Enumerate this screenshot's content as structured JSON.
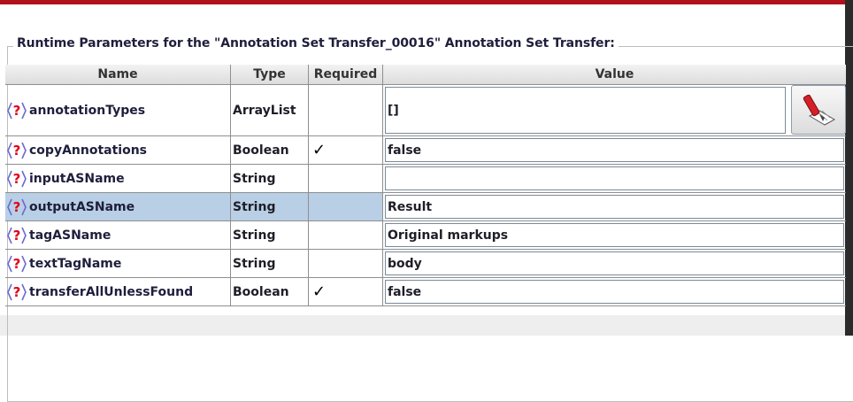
{
  "panel": {
    "title": "Runtime Parameters for the \"Annotation Set Transfer_00016\" Annotation Set Transfer:"
  },
  "table": {
    "columns": [
      "Name",
      "Type",
      "Required",
      "Value"
    ],
    "rows": [
      {
        "name": "annotationTypes",
        "type": "ArrayList",
        "required": "",
        "value": "[]",
        "selected": false
      },
      {
        "name": "copyAnnotations",
        "type": "Boolean",
        "required": "✓",
        "value": "false",
        "selected": false
      },
      {
        "name": "inputASName",
        "type": "String",
        "required": "",
        "value": "",
        "selected": false
      },
      {
        "name": "outputASName",
        "type": "String",
        "required": "",
        "value": "Result",
        "selected": true
      },
      {
        "name": "tagASName",
        "type": "String",
        "required": "",
        "value": "Original markups",
        "selected": false
      },
      {
        "name": "textTagName",
        "type": "String",
        "required": "",
        "value": "body",
        "selected": false
      },
      {
        "name": "transferAllUnlessFound",
        "type": "Boolean",
        "required": "✓",
        "value": "false",
        "selected": false
      }
    ]
  },
  "icons": {
    "param_help": "question-icon",
    "list_editor": "edit-list-icon"
  },
  "colors": {
    "accent_red": "#b0111c",
    "selection": "#b8cfe5"
  }
}
